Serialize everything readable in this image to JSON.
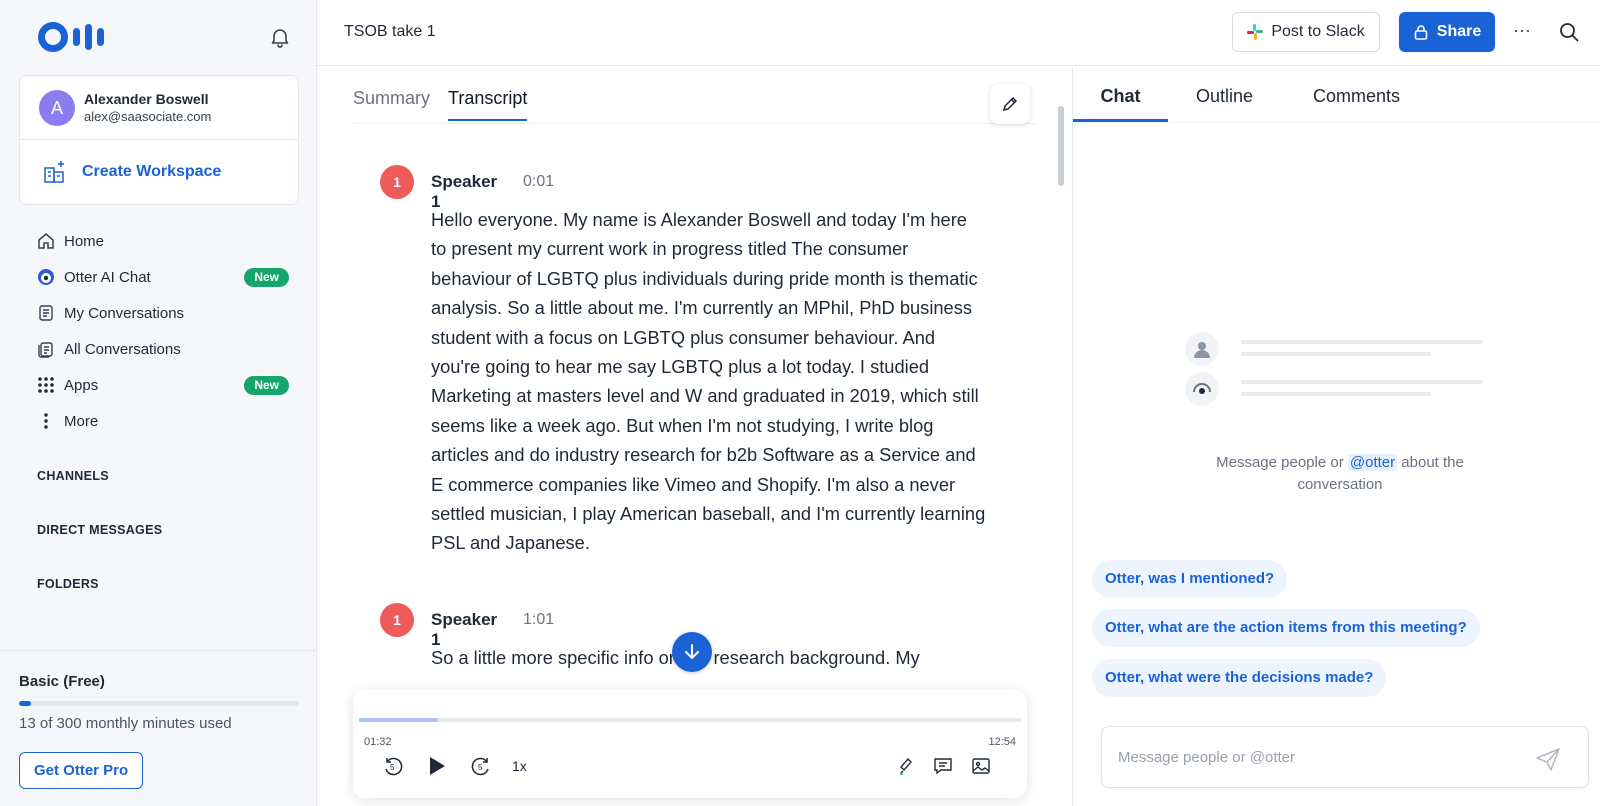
{
  "sidebar": {
    "account": {
      "avatar_initial": "A",
      "name": "Alexander Boswell",
      "email": "alex@saasociate.com",
      "create_workspace_label": "Create Workspace"
    },
    "nav": [
      {
        "label": "Home",
        "icon": "home-icon"
      },
      {
        "label": "Otter AI Chat",
        "icon": "otter-ai-icon",
        "badge": "New"
      },
      {
        "label": "My Conversations",
        "icon": "document-icon"
      },
      {
        "label": "All Conversations",
        "icon": "documents-icon"
      },
      {
        "label": "Apps",
        "icon": "grid-icon",
        "badge": "New"
      },
      {
        "label": "More",
        "icon": "vertical-dots-icon"
      }
    ],
    "sections": {
      "channels": "CHANNELS",
      "direct_messages": "DIRECT MESSAGES",
      "folders": "FOLDERS"
    },
    "plan": {
      "name": "Basic (Free)",
      "minutes_used_fraction": 0.043,
      "usage_text": "13 of 300 monthly minutes used",
      "upgrade_label": "Get Otter Pro"
    }
  },
  "header": {
    "title": "TSOB take 1",
    "post_to_slack": "Post to Slack",
    "share": "Share",
    "more": "···"
  },
  "transcript": {
    "tabs": {
      "summary": "Summary",
      "transcript": "Transcript"
    },
    "blocks": [
      {
        "speaker_number": "1",
        "speaker": "Speaker 1",
        "time": "0:01",
        "text": "Hello everyone. My name is Alexander Boswell and today I'm here to present my current work in progress titled The consumer behaviour of LGBTQ plus individuals during pride month is thematic analysis. So a little about me. I'm currently an MPhil, PhD business student with a focus on LGBTQ plus consumer behaviour. And you're going to hear me say LGBTQ plus a lot today. I studied Marketing at masters level and W and graduated in 2019, which still seems like a week ago. But when I'm not studying, I write blog articles and do industry research for b2b Software as a Service and E commerce companies like Vimeo and Shopify. I'm also a never settled musician, I play American baseball, and I'm currently learning PSL and Japanese."
      },
      {
        "speaker_number": "1",
        "speaker": "Speaker 1",
        "time": "1:01",
        "text": "So a little more specific info on my research background. My"
      }
    ],
    "player": {
      "current_time": "01:32",
      "total_time": "12:54",
      "progress_fraction": 0.119,
      "speed": "1x"
    }
  },
  "chat": {
    "tabs": {
      "chat": "Chat",
      "outline": "Outline",
      "comments": "Comments"
    },
    "empty_state": {
      "before": "Message people or ",
      "mention": "@otter",
      "after": " about the conversation"
    },
    "suggestions": [
      "Otter, was I mentioned?",
      "Otter, what are the action items from this meeting?",
      "Otter, what were the decisions made?"
    ],
    "input_placeholder": "Message people or @otter"
  },
  "colors": {
    "brand": "#1a63d6",
    "badge": "#16a56b",
    "speaker": "#ef5b5b",
    "avatar": "#8b7cf0"
  }
}
